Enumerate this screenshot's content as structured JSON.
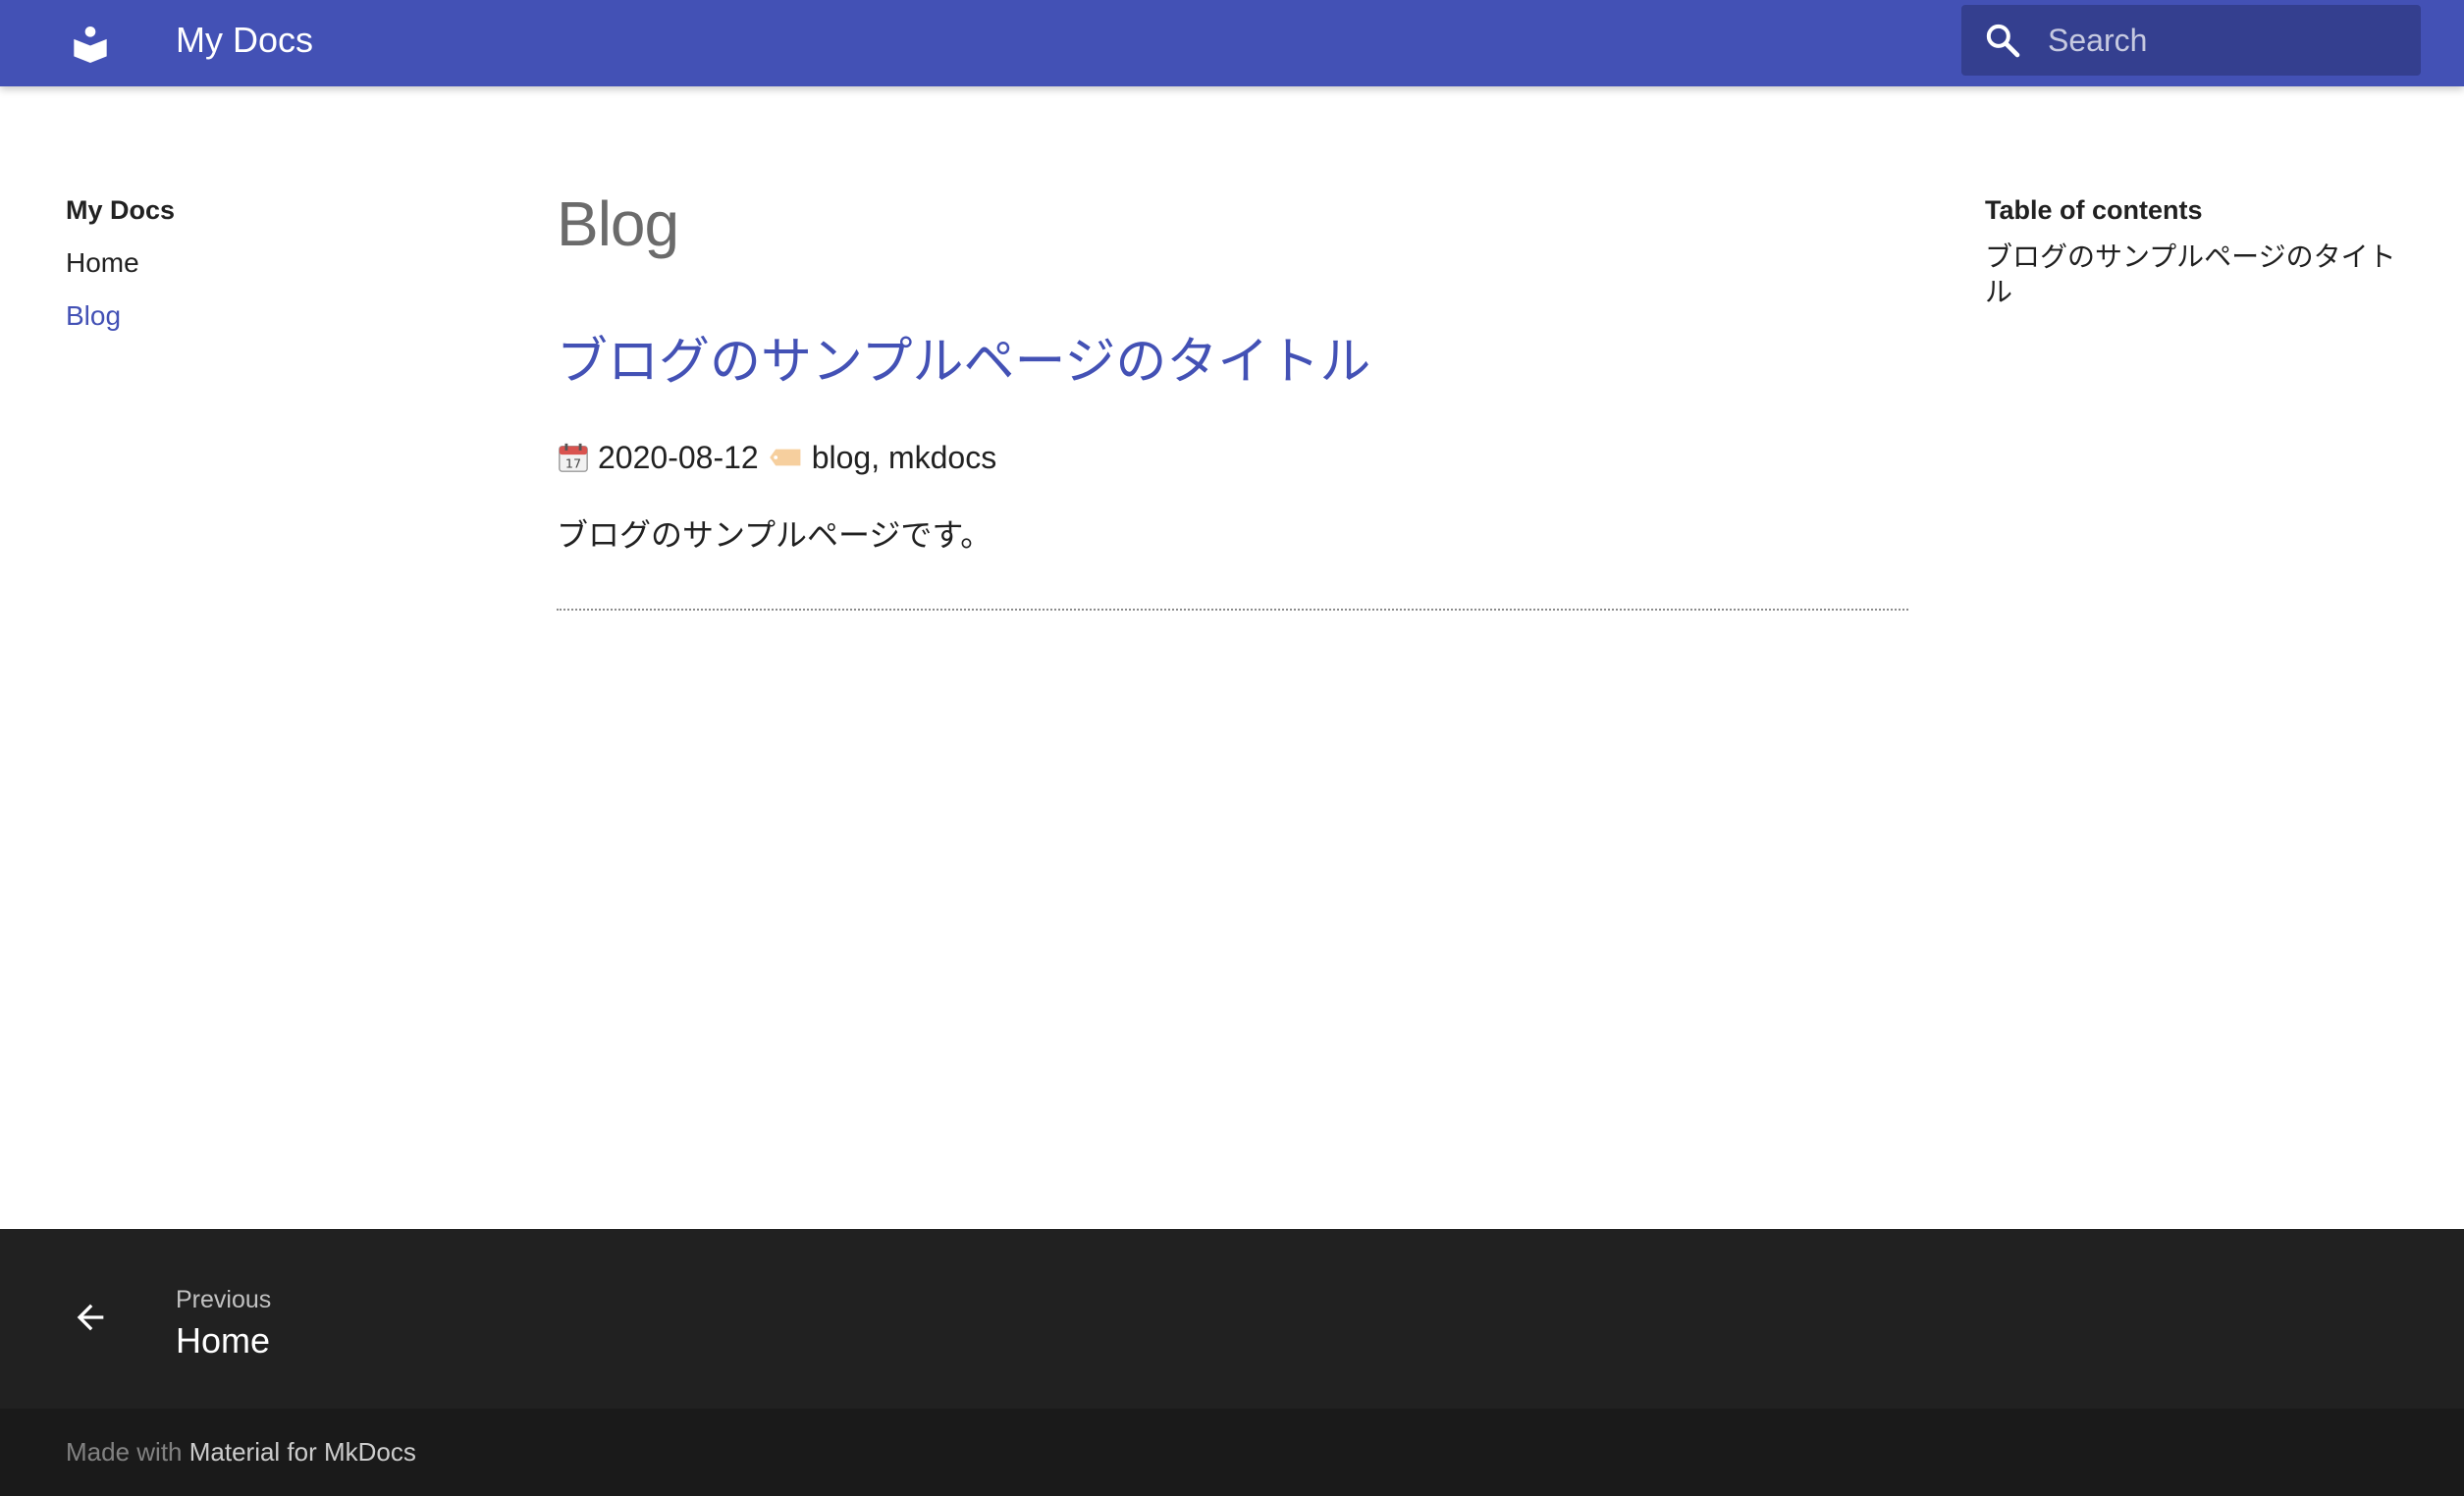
{
  "header": {
    "site_title": "My Docs",
    "logo_icon": "book-reader-icon",
    "search_placeholder": "Search",
    "search_icon": "search-icon",
    "primary_color": "#4351b5"
  },
  "nav": {
    "title": "My Docs",
    "items": [
      {
        "label": "Home",
        "active": false
      },
      {
        "label": "Blog",
        "active": true
      }
    ]
  },
  "content": {
    "page_title": "Blog",
    "post_title": "ブログのサンプルページのタイトル",
    "date_icon": "calendar-icon",
    "date": "2020-08-12",
    "tag_icon": "tag-icon",
    "tags": "blog, mkdocs",
    "body": "ブログのサンプルページです。"
  },
  "toc": {
    "title": "Table of contents",
    "items": [
      "ブログのサンプルページのタイトル"
    ]
  },
  "footer": {
    "prev_icon": "arrow-left-icon",
    "prev_direction": "Previous",
    "prev_title": "Home",
    "made_with_prefix": "Made with",
    "made_with_link": "Material for MkDocs"
  }
}
